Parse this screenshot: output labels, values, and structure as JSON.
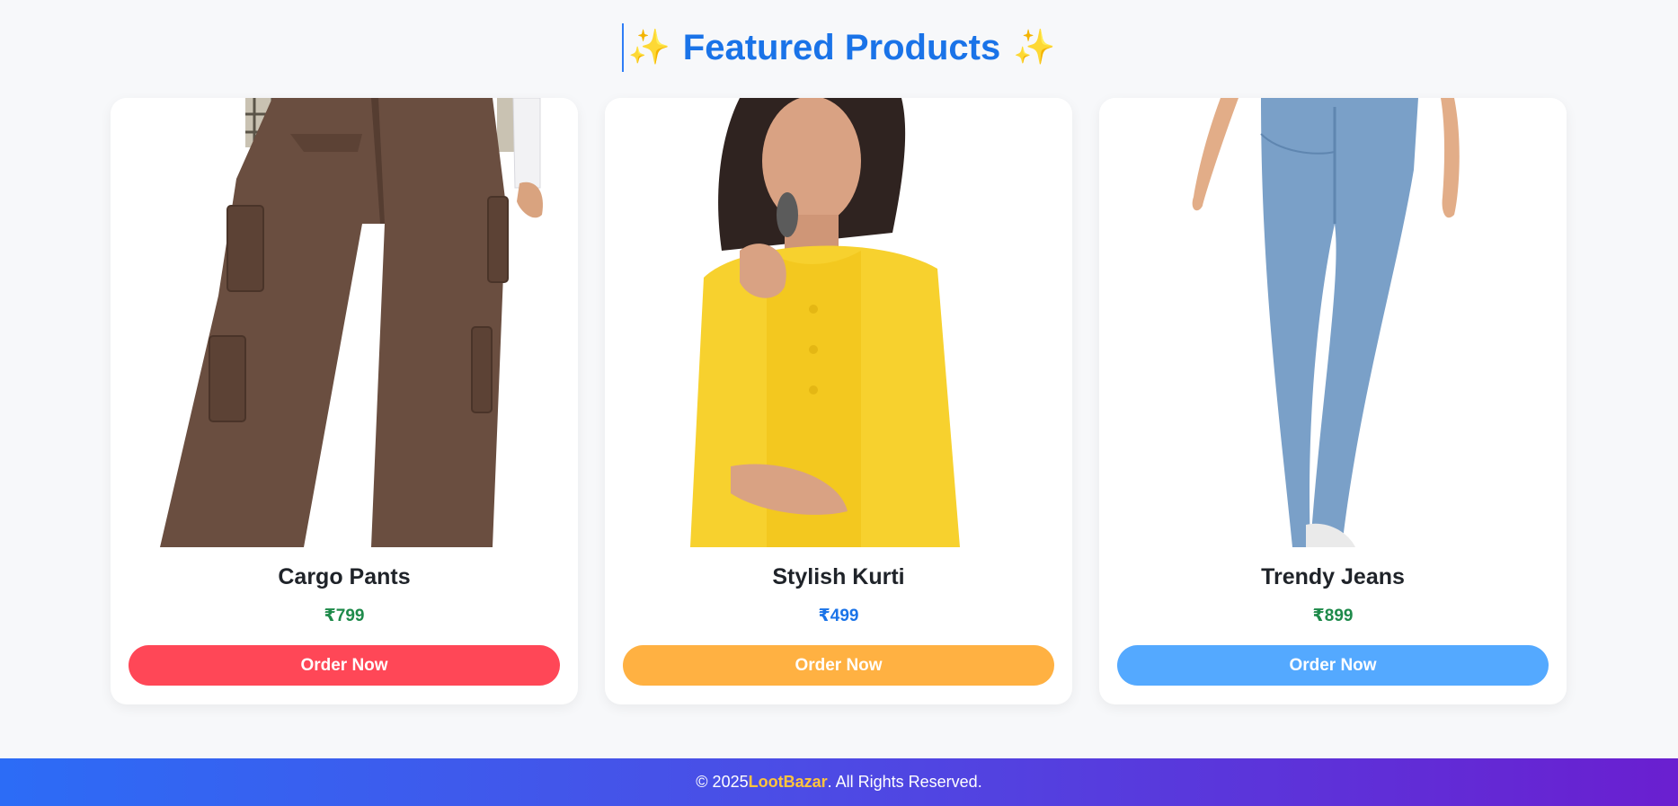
{
  "section": {
    "title": "Featured Products",
    "sparkle_left": "✨",
    "sparkle_right": "✨"
  },
  "products": [
    {
      "name": "Cargo Pants",
      "price": "₹799",
      "price_color": "#1e8a4a",
      "button_label": "Order Now",
      "button_color": "#ff4757",
      "image": "cargo-pants-photo"
    },
    {
      "name": "Stylish Kurti",
      "price": "₹499",
      "price_color": "#1a73e8",
      "button_label": "Order Now",
      "button_color": "#ffb142",
      "image": "yellow-kurti-photo"
    },
    {
      "name": "Trendy Jeans",
      "price": "₹899",
      "price_color": "#1e8a4a",
      "button_label": "Order Now",
      "button_color": "#54a9ff",
      "image": "blue-jeans-photo"
    }
  ],
  "footer": {
    "prefix": "© 2025 ",
    "brand": "LootBazar",
    "suffix": ". All Rights Reserved."
  }
}
